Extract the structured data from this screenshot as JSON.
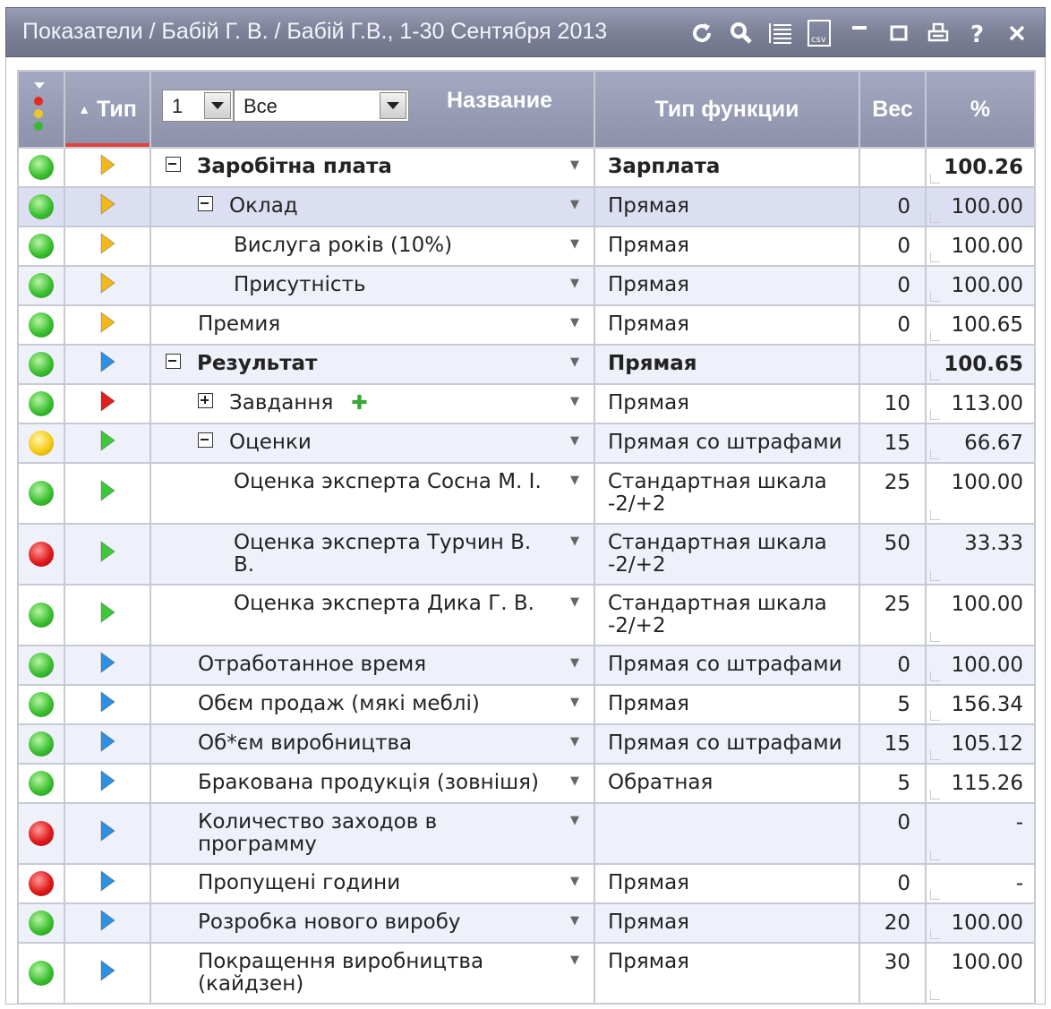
{
  "window": {
    "title": "Показатели / Бабій Г. В. / Бабій Г.В., 1-30 Сентября 2013",
    "toolbar": [
      {
        "icon": "refresh-icon"
      },
      {
        "icon": "search-icon"
      },
      {
        "icon": "list-icon"
      },
      {
        "icon": "csv-export-icon",
        "label": "csv"
      },
      {
        "icon": "minimize-icon"
      },
      {
        "icon": "maximize-icon"
      },
      {
        "icon": "print-icon"
      },
      {
        "icon": "help-icon",
        "label": "?"
      },
      {
        "icon": "close-icon"
      }
    ]
  },
  "grid": {
    "columns": {
      "status": "",
      "type": "Тип",
      "type_sort_icon": "sort-asc-icon",
      "level_select": "1",
      "filter_select": "Все",
      "name": "Название",
      "function": "Тип функции",
      "weight": "Вес",
      "percent": "%"
    },
    "rows": [
      {
        "status": "green",
        "type": "yellow",
        "name": "Заробітна плата",
        "indent": 0,
        "expander": "minus",
        "bold": true,
        "function": "Зарплата",
        "weight": "",
        "percent": "100.26",
        "height": 44
      },
      {
        "status": "green",
        "type": "yellow",
        "name": "Оклад",
        "indent": 1,
        "expander": "minus",
        "bold": false,
        "function": "Прямая",
        "weight": "0",
        "percent": "100.00",
        "height": 44,
        "selected": true
      },
      {
        "status": "green",
        "type": "yellow",
        "name": "Вислуга років (10%)",
        "indent": 2,
        "bold": false,
        "function": "Прямая",
        "weight": "0",
        "percent": "100.00",
        "height": 44
      },
      {
        "status": "green",
        "type": "yellow",
        "name": "Присутність",
        "indent": 2,
        "bold": false,
        "function": "Прямая",
        "weight": "0",
        "percent": "100.00",
        "height": 44
      },
      {
        "status": "green",
        "type": "yellow",
        "name": "Премия",
        "indent": 1,
        "bold": false,
        "function": "Прямая",
        "weight": "0",
        "percent": "100.65",
        "height": 44
      },
      {
        "status": "green",
        "type": "blue",
        "name": "Результат",
        "indent": 0,
        "expander": "minus",
        "bold": true,
        "function": "Прямая",
        "function_bold": true,
        "weight": "",
        "percent": "100.65",
        "height": 44
      },
      {
        "status": "green",
        "type": "red",
        "name": "Завдання",
        "indent": 1,
        "expander": "plus",
        "bold": false,
        "add": "✚",
        "function": "Прямая",
        "weight": "10",
        "percent": "113.00",
        "height": 44
      },
      {
        "status": "yellow",
        "type": "green",
        "name": "Оценки",
        "indent": 1,
        "expander": "minus",
        "bold": false,
        "function": "Прямая со штрафами",
        "weight": "15",
        "percent": "66.67",
        "height": 44
      },
      {
        "status": "green",
        "type": "green",
        "name": "Оценка эксперта Сосна М. І.",
        "indent": 2,
        "bold": false,
        "function": "Стандартная шкала -2/+2",
        "weight": "25",
        "percent": "100.00",
        "height": 68
      },
      {
        "status": "red",
        "type": "green",
        "name": "Оценка эксперта Турчин В. В.",
        "indent": 2,
        "bold": false,
        "function": "Стандартная шкала -2/+2",
        "weight": "50",
        "percent": "33.33",
        "height": 68
      },
      {
        "status": "green",
        "type": "green",
        "name": "Оценка эксперта Дика Г. В.",
        "indent": 2,
        "bold": false,
        "function": "Стандартная шкала -2/+2",
        "weight": "25",
        "percent": "100.00",
        "height": 68
      },
      {
        "status": "green",
        "type": "blue",
        "name": "Отработанное время",
        "indent": 1,
        "bold": false,
        "function": "Прямая со штрафами",
        "weight": "0",
        "percent": "100.00",
        "height": 44
      },
      {
        "status": "green",
        "type": "blue",
        "name": "Обєм продаж (мякі меблі)",
        "indent": 1,
        "bold": false,
        "function": "Прямая",
        "weight": "5",
        "percent": "156.34",
        "height": 44
      },
      {
        "status": "green",
        "type": "blue",
        "name": "Об*єм виробництва",
        "indent": 1,
        "bold": false,
        "function": "Прямая со штрафами",
        "weight": "15",
        "percent": "105.12",
        "height": 44
      },
      {
        "status": "green",
        "type": "blue",
        "name": "Бракована продукція (зовнішя)",
        "indent": 1,
        "bold": false,
        "function": "Обратная",
        "weight": "5",
        "percent": "115.26",
        "height": 44
      },
      {
        "status": "red",
        "type": "blue",
        "name": "Количество заходов в программу",
        "indent": 1,
        "bold": false,
        "function": "",
        "weight": "0",
        "percent": "-",
        "height": 68
      },
      {
        "status": "red",
        "type": "blue",
        "name": "Пропущені години",
        "indent": 1,
        "bold": false,
        "function": "Прямая",
        "weight": "0",
        "percent": "-",
        "height": 44
      },
      {
        "status": "green",
        "type": "blue",
        "name": "Розробка нового виробу",
        "indent": 1,
        "bold": false,
        "function": "Прямая",
        "weight": "20",
        "percent": "100.00",
        "height": 44
      },
      {
        "status": "green",
        "type": "blue",
        "name": "Покращення виробництва (кайдзен)",
        "indent": 1,
        "bold": false,
        "function": "Прямая",
        "weight": "30",
        "percent": "100.00",
        "height": 68
      }
    ]
  },
  "colors": {
    "status_green": "#3cc031",
    "status_red": "#e01a1a",
    "status_yellow": "#f5cc14",
    "type_yellow": "#f2b81c",
    "type_blue": "#2f8fe0",
    "type_red": "#e0201c",
    "type_green": "#3cc83a",
    "header_bg": "#9599b2",
    "row_alt_bg": "#eef0fa",
    "row_selected_bg": "#dcdff1"
  }
}
